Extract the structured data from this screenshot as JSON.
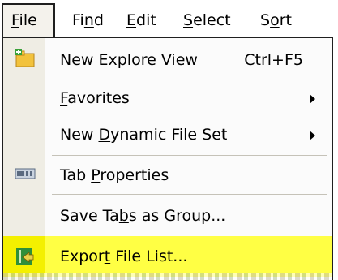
{
  "menubar": {
    "items": [
      {
        "label_pre": "",
        "label_key": "F",
        "label_post": "ile",
        "active": true
      },
      {
        "label_pre": "Fi",
        "label_key": "n",
        "label_post": "d"
      },
      {
        "label_pre": "",
        "label_key": "E",
        "label_post": "dit"
      },
      {
        "label_pre": "",
        "label_key": "S",
        "label_post": "elect"
      },
      {
        "label_pre": "S",
        "label_key": "o",
        "label_post": "rt"
      }
    ]
  },
  "file_menu": {
    "items": [
      {
        "icon": "explore-view-icon",
        "pre": "New ",
        "key": "E",
        "post": "xplore View",
        "shortcut": "Ctrl+F5"
      },
      {
        "icon": "",
        "pre": "",
        "key": "F",
        "post": "avorites",
        "submenu": true
      },
      {
        "icon": "",
        "pre": "New ",
        "key": "D",
        "post": "ynamic File Set",
        "submenu": true
      },
      {
        "icon": "tab-properties-icon",
        "pre": "Tab ",
        "key": "P",
        "post": "roperties"
      },
      {
        "icon": "",
        "pre": "Save Ta",
        "key": "b",
        "post": "s as Group..."
      },
      {
        "icon": "export-file-list-icon",
        "pre": "Expor",
        "key": "t",
        "post": " File List...",
        "highlighted": true
      }
    ]
  },
  "colors": {
    "highlight": "#ffff44",
    "gutter": "#efede4",
    "border": "#1f1f1f"
  }
}
